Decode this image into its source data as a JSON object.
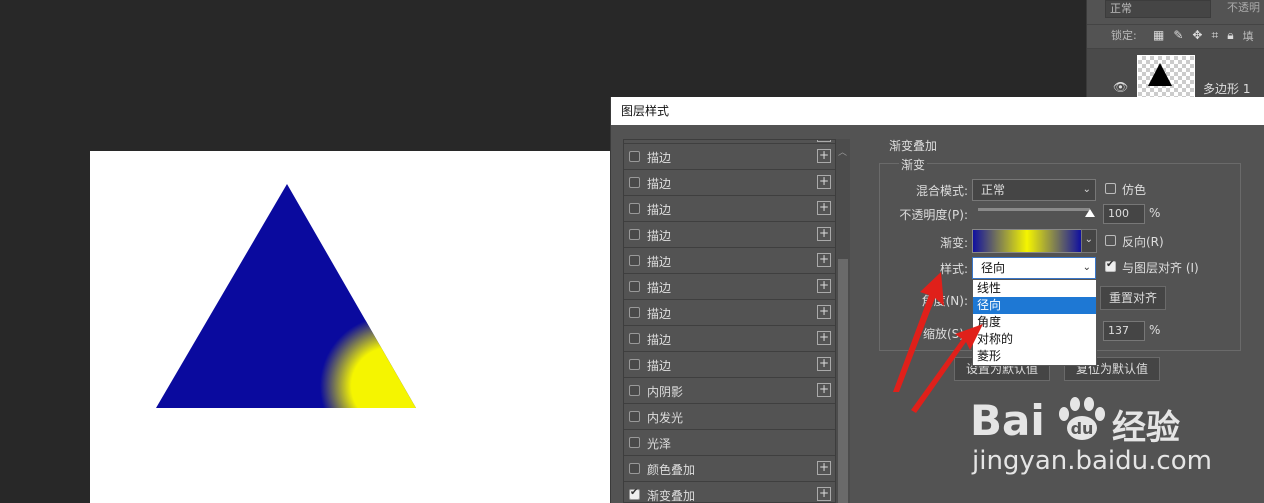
{
  "layers_panel": {
    "blend_mode": "正常",
    "opacity_label": "不透明",
    "lock_label": "锁定:",
    "lock_icons": [
      "checker-lock-icon",
      "brush-lock-icon",
      "move-lock-icon",
      "artboard-lock-icon",
      "padlock-icon"
    ],
    "lock_fill_label": "填",
    "layer_name": "多边形 1",
    "visibility_icon": "eye-icon"
  },
  "dialog": {
    "title": "图层样式",
    "style_list": [
      {
        "label": "",
        "checked": false,
        "plus": true,
        "partial": true
      },
      {
        "label": "描边",
        "checked": false,
        "plus": true
      },
      {
        "label": "描边",
        "checked": false,
        "plus": true
      },
      {
        "label": "描边",
        "checked": false,
        "plus": true
      },
      {
        "label": "描边",
        "checked": false,
        "plus": true
      },
      {
        "label": "描边",
        "checked": false,
        "plus": true
      },
      {
        "label": "描边",
        "checked": false,
        "plus": true
      },
      {
        "label": "描边",
        "checked": false,
        "plus": true
      },
      {
        "label": "描边",
        "checked": false,
        "plus": true
      },
      {
        "label": "描边",
        "checked": false,
        "plus": true
      },
      {
        "label": "内阴影",
        "checked": false,
        "plus": true
      },
      {
        "label": "内发光",
        "checked": false,
        "plus": false
      },
      {
        "label": "光泽",
        "checked": false,
        "plus": false
      },
      {
        "label": "颜色叠加",
        "checked": false,
        "plus": true
      },
      {
        "label": "渐变叠加",
        "checked": true,
        "plus": true
      }
    ],
    "section_title": "渐变叠加",
    "group_title": "渐变",
    "blend_mode_label": "混合模式:",
    "blend_mode_value": "正常",
    "dither_label": "仿色",
    "opacity_label": "不透明度(P):",
    "opacity_value": "100",
    "opacity_fraction": 1.0,
    "percent": "%",
    "gradient_label": "渐变:",
    "gradient_colors": [
      "#1010a0",
      "#f5f500",
      "#1010a0"
    ],
    "reverse_label": "反向(R)",
    "style_label": "样式:",
    "style_value": "径向",
    "align_label": "与图层对齐 (I)",
    "angle_label": "角度(N):",
    "reset_align_button": "重置对齐",
    "scale_label": "缩放(S):",
    "scale_value": "137",
    "make_default_button": "设置为默认值",
    "reset_default_button": "复位为默认值",
    "style_options": [
      "线性",
      "径向",
      "角度",
      "对称的",
      "菱形"
    ],
    "style_selected_index": 1
  },
  "canvas": {
    "triangle_color": "#0a0a9e",
    "highlight_color": "#f5f500"
  },
  "watermark": {
    "brand": "Bai",
    "brand_suffix": "经验",
    "url": "jingyan.baidu.com"
  }
}
